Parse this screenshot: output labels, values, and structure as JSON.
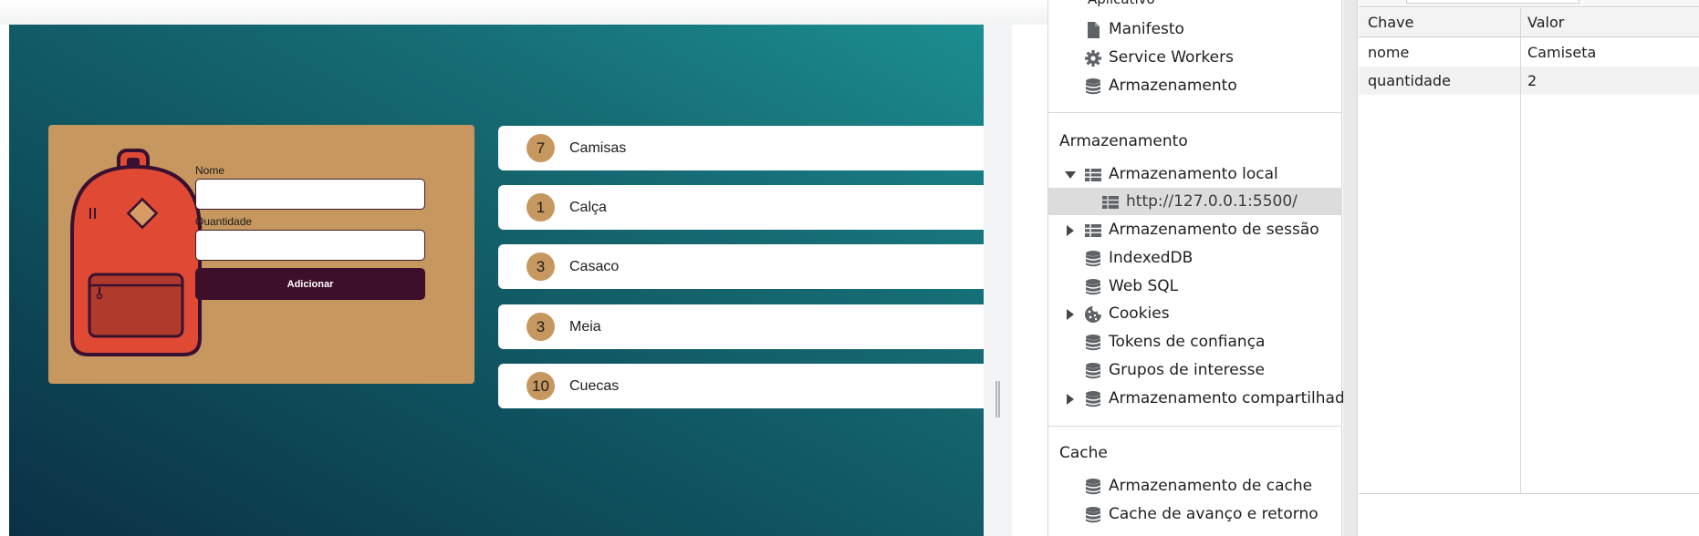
{
  "app": {
    "form": {
      "name_label": "Nome",
      "name_value": "",
      "quantity_label": "Quantidade",
      "quantity_value": "",
      "submit_label": "Adicionar"
    },
    "items": [
      {
        "quantity": "7",
        "name": "Camisas"
      },
      {
        "quantity": "1",
        "name": "Calça"
      },
      {
        "quantity": "3",
        "name": "Casaco"
      },
      {
        "quantity": "3",
        "name": "Meia"
      },
      {
        "quantity": "10",
        "name": "Cuecas"
      }
    ],
    "colors": {
      "card": "#c6975f",
      "button": "#3e0f2a",
      "backpack": "#e04a35",
      "background_dark": "#0b3144",
      "background_light": "#1b8e90"
    }
  },
  "devtools": {
    "sidebar": {
      "top_heading": "Aplicativo",
      "app_items": [
        {
          "label": "Manifesto",
          "icon": "file-icon"
        },
        {
          "label": "Service Workers",
          "icon": "gear-icon"
        },
        {
          "label": "Armazenamento",
          "icon": "database-icon"
        }
      ],
      "storage_title": "Armazenamento",
      "storage_items": [
        {
          "label": "Armazenamento local",
          "icon": "grid-icon",
          "expander": "expanded"
        },
        {
          "label": "http://127.0.0.1:5500/",
          "icon": "grid-icon",
          "selected": true
        },
        {
          "label": "Armazenamento de sessão",
          "icon": "grid-icon",
          "expander": "collapsed"
        },
        {
          "label": "IndexedDB",
          "icon": "database-icon"
        },
        {
          "label": "Web SQL",
          "icon": "database-icon"
        },
        {
          "label": "Cookies",
          "icon": "cookie-icon",
          "expander": "collapsed"
        },
        {
          "label": "Tokens de confiança",
          "icon": "database-icon"
        },
        {
          "label": "Grupos de interesse",
          "icon": "database-icon"
        },
        {
          "label": "Armazenamento compartilhado",
          "icon": "database-icon",
          "expander": "collapsed"
        }
      ],
      "cache_title": "Cache",
      "cache_items": [
        {
          "label": "Armazenamento de cache",
          "icon": "database-icon"
        },
        {
          "label": "Cache de avanço e retorno",
          "icon": "database-icon"
        }
      ]
    },
    "table": {
      "columns": [
        "Chave",
        "Valor"
      ],
      "rows": [
        {
          "key": "nome",
          "value": "Camiseta"
        },
        {
          "key": "quantidade",
          "value": "2"
        }
      ]
    }
  }
}
